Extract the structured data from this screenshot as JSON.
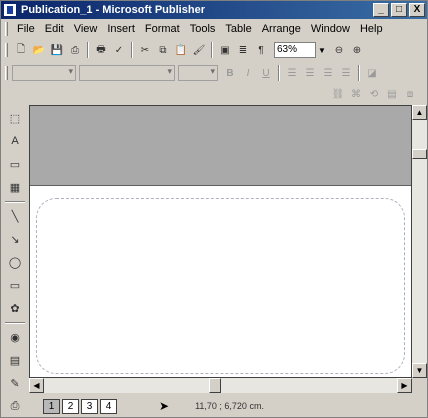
{
  "window": {
    "title": "Publication_1 - Microsoft Publisher",
    "minimize": "_",
    "maximize": "□",
    "close": "X"
  },
  "menu": [
    "File",
    "Edit",
    "View",
    "Insert",
    "Format",
    "Tools",
    "Table",
    "Arrange",
    "Window",
    "Help"
  ],
  "toolbar": {
    "zoom_value": "63%"
  },
  "statusbar": {
    "pages": [
      "1",
      "2",
      "3",
      "4"
    ],
    "active_page": "1",
    "coordinates": "11,70 ; 6,720 cm."
  },
  "icons": {
    "standard_toolbar": [
      "new-icon",
      "open-icon",
      "save-icon",
      "publish-icon",
      "print-icon",
      "spell-check-icon",
      "cut-icon",
      "copy-icon",
      "paste-icon",
      "format-painter-icon",
      "special-characters-icon",
      "columns-icon",
      "paragraph-marks-icon",
      "zoom-out-icon",
      "zoom-in-icon"
    ],
    "formatting_toolbar": [
      "style-select",
      "font-select",
      "size-select",
      "bold-icon",
      "italic-icon",
      "underline-icon",
      "align-left-icon",
      "align-center-icon",
      "align-right-icon",
      "justify-icon",
      "fill-color-icon"
    ],
    "objects_toolbar": [
      "pointer-icon",
      "text-frame-icon",
      "wordart-icon",
      "picture-frame-icon",
      "clip-gallery-icon",
      "line-icon",
      "arrow-icon",
      "oval-icon",
      "rectangle-icon",
      "custom-shapes-icon",
      "hotspot-icon",
      "form-control-icon",
      "html-code-icon",
      "design-gallery-icon"
    ]
  }
}
